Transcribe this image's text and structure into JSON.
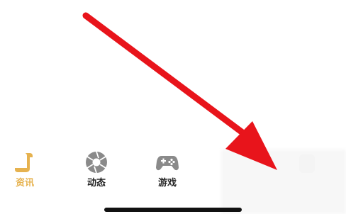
{
  "tabbar": {
    "tabs": [
      {
        "label": "资讯",
        "icon": "scroll-icon",
        "active": true
      },
      {
        "label": "动态",
        "icon": "aperture-icon",
        "active": false
      },
      {
        "label": "游戏",
        "icon": "gamepad-icon",
        "active": false
      }
    ]
  },
  "colors": {
    "active": "#e6b24f",
    "inactive_icon": "#8a8a8a",
    "arrow": "#e8141b"
  }
}
